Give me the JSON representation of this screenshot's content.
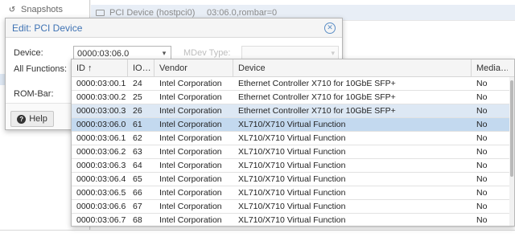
{
  "background": {
    "sidebar": {
      "snapshots_label": "Snapshots",
      "snapshots_icon": "history-icon"
    },
    "rows": [
      {
        "icon": "pci-card-icon",
        "name": "PCI Device (hostpci0)",
        "value": "03:06.0,rombar=0"
      }
    ]
  },
  "dialog": {
    "title": "Edit: PCI Device",
    "close_icon": "close-icon",
    "device_label": "Device:",
    "device_value": "0000:03:06.0",
    "mdev_label": "MDev Type:",
    "all_functions_label": "All Functions:",
    "rom_bar_label": "ROM-Bar:",
    "help_label": "Help"
  },
  "grid": {
    "columns": [
      "ID ↑",
      "IO…",
      "Vendor",
      "Device",
      "Media…"
    ],
    "selected_index": 3,
    "highlighted_index": 2,
    "rows": [
      {
        "id": "0000:03:00.1",
        "io": "24",
        "vendor": "Intel Corporation",
        "device": "Ethernet Controller X710 for 10GbE SFP+",
        "mediated": "No"
      },
      {
        "id": "0000:03:00.2",
        "io": "25",
        "vendor": "Intel Corporation",
        "device": "Ethernet Controller X710 for 10GbE SFP+",
        "mediated": "No"
      },
      {
        "id": "0000:03:00.3",
        "io": "26",
        "vendor": "Intel Corporation",
        "device": "Ethernet Controller X710 for 10GbE SFP+",
        "mediated": "No"
      },
      {
        "id": "0000:03:06.0",
        "io": "61",
        "vendor": "Intel Corporation",
        "device": "XL710/X710 Virtual Function",
        "mediated": "No"
      },
      {
        "id": "0000:03:06.1",
        "io": "62",
        "vendor": "Intel Corporation",
        "device": "XL710/X710 Virtual Function",
        "mediated": "No"
      },
      {
        "id": "0000:03:06.2",
        "io": "63",
        "vendor": "Intel Corporation",
        "device": "XL710/X710 Virtual Function",
        "mediated": "No"
      },
      {
        "id": "0000:03:06.3",
        "io": "64",
        "vendor": "Intel Corporation",
        "device": "XL710/X710 Virtual Function",
        "mediated": "No"
      },
      {
        "id": "0000:03:06.4",
        "io": "65",
        "vendor": "Intel Corporation",
        "device": "XL710/X710 Virtual Function",
        "mediated": "No"
      },
      {
        "id": "0000:03:06.5",
        "io": "66",
        "vendor": "Intel Corporation",
        "device": "XL710/X710 Virtual Function",
        "mediated": "No"
      },
      {
        "id": "0000:03:06.6",
        "io": "67",
        "vendor": "Intel Corporation",
        "device": "XL710/X710 Virtual Function",
        "mediated": "No"
      },
      {
        "id": "0000:03:06.7",
        "io": "68",
        "vendor": "Intel Corporation",
        "device": "XL710/X710 Virtual Function",
        "mediated": "No"
      }
    ]
  },
  "colors": {
    "accent": "#3f73b4",
    "selected_row": "#c3d9ef",
    "highlighted_row": "#dde8f4"
  }
}
